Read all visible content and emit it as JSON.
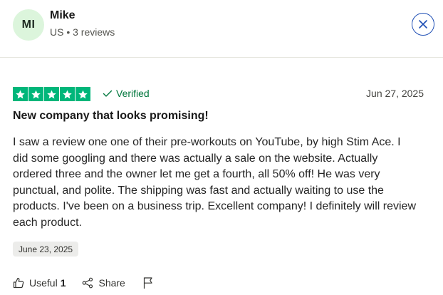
{
  "reviewer": {
    "initials": "MI",
    "name": "Mike",
    "meta": "US • 3 reviews"
  },
  "review": {
    "rating": 5,
    "verified_label": "Verified",
    "date": "Jun 27, 2025",
    "title": "New company that looks promising!",
    "body": "I saw a review one one of their pre-workouts on YouTube, by high Stim Ace. I did some googling and there was actually a sale on the website. Actually ordered three and the owner let me get a fourth, all 50% off! He was very punctual, and polite. The shipping was fast and actually waiting to use the products. I've been on a business trip. Excellent company! I definitely will review each product.",
    "experience_date": "June 23, 2025"
  },
  "actions": {
    "useful_label": "Useful",
    "useful_count": "1",
    "share_label": "Share"
  },
  "icons": {
    "close": "close-icon",
    "star": "star-icon",
    "verified": "check-icon",
    "useful": "thumbs-up-icon",
    "share": "share-icon",
    "flag": "flag-icon"
  },
  "colors": {
    "star_green": "#00b67a",
    "verified_green": "#00773d",
    "avatar_bg": "#dcf5dc",
    "close_blue": "#1f4fb5"
  }
}
